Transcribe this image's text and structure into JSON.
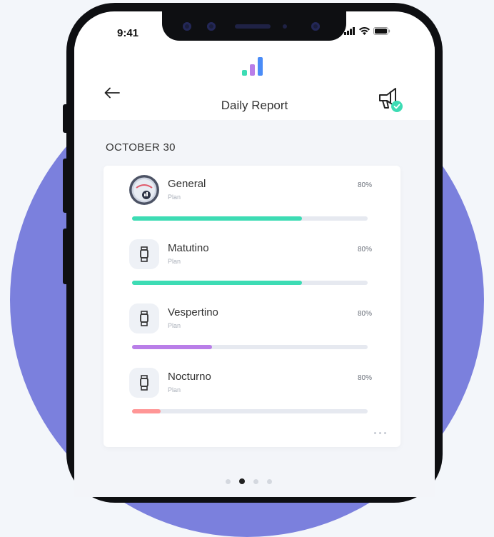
{
  "status_bar": {
    "time": "9:41"
  },
  "header": {
    "title": "Daily Report"
  },
  "date_label": "OCTOBER 30",
  "items": [
    {
      "name": "General",
      "sub": "Plan",
      "percent": "80%",
      "progress": 0.72,
      "color": "#3ddcb4"
    },
    {
      "name": "Matutino",
      "sub": "Plan",
      "percent": "80%",
      "progress": 0.72,
      "color": "#3ddcb4"
    },
    {
      "name": "Vespertino",
      "sub": "Plan",
      "percent": "80%",
      "progress": 0.34,
      "color": "#b97ee8"
    },
    {
      "name": "Nocturno",
      "sub": "Plan",
      "percent": "80%",
      "progress": 0.12,
      "color": "#ff9696"
    }
  ],
  "pager": {
    "count": 4,
    "active": 1
  },
  "colors": {
    "background_circle": "#7b80dd",
    "accent_green": "#3ddcb4",
    "logo_blue": "#4a8cf7"
  },
  "icons": [
    "back-arrow-icon",
    "megaphone-check-icon",
    "watch-icon",
    "more-icon",
    "signal-icon",
    "wifi-icon",
    "battery-icon"
  ]
}
